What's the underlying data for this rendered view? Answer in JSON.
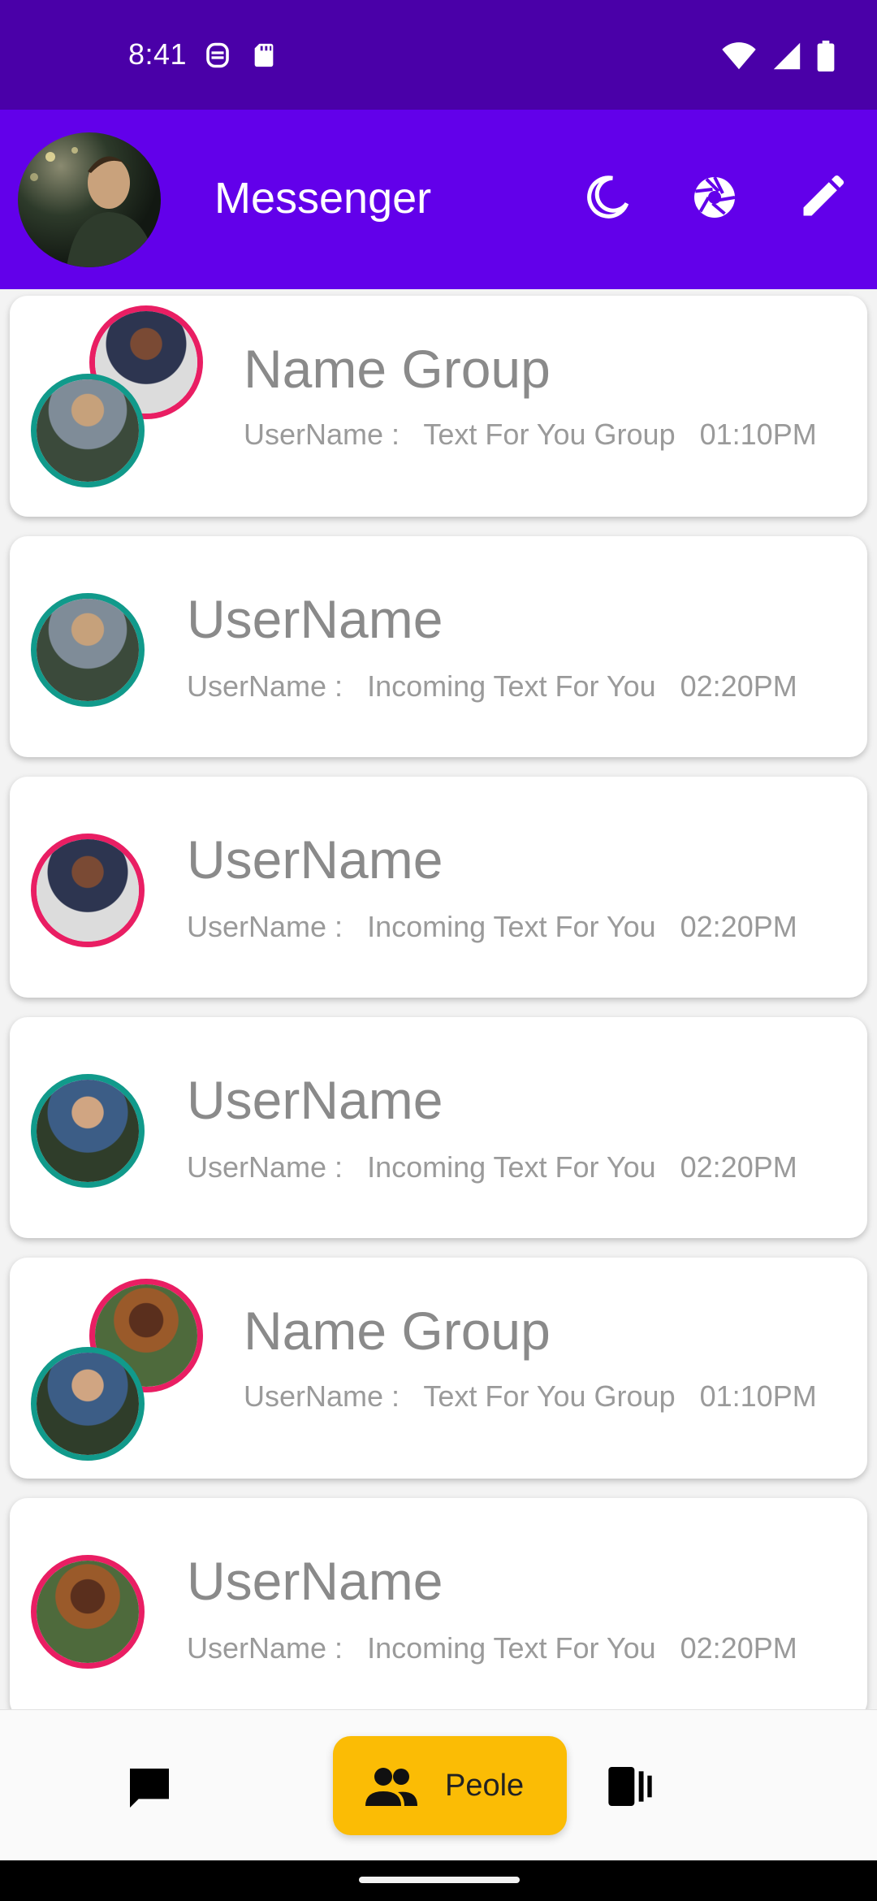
{
  "status_bar": {
    "time": "8:41",
    "left_icons": [
      "face-icon",
      "sd-card-icon"
    ],
    "right_icons": [
      "wifi-icon",
      "signal-icon",
      "battery-icon"
    ]
  },
  "app_bar": {
    "title": "Messenger",
    "background": "#6200ea",
    "actions": [
      "moon-icon",
      "camera-aperture-icon",
      "edit-pencil-icon"
    ]
  },
  "chats": [
    {
      "type": "group",
      "title": "Name Group",
      "sender": "UserName :",
      "message": "Text For You Group",
      "time": "01:10PM"
    },
    {
      "type": "single",
      "title": "UserName",
      "sender": "UserName :",
      "message": "Incoming Text For You",
      "time": "02:20PM"
    },
    {
      "type": "single",
      "title": "UserName",
      "sender": "UserName :",
      "message": "Incoming Text For You",
      "time": "02:20PM"
    },
    {
      "type": "single",
      "title": "UserName",
      "sender": "UserName :",
      "message": "Incoming Text For You",
      "time": "02:20PM"
    },
    {
      "type": "group",
      "title": "Name Group",
      "sender": "UserName :",
      "message": "Text For You Group",
      "time": "01:10PM"
    },
    {
      "type": "single",
      "title": "UserName",
      "sender": "UserName :",
      "message": "Incoming Text For You",
      "time": "02:20PM"
    }
  ],
  "bottom_nav": {
    "items": [
      {
        "icon": "chat-bubble-icon"
      },
      {
        "icon": "people-icon",
        "label": "Peole",
        "selected": true
      },
      {
        "icon": "stories-icon"
      }
    ],
    "accent": "#fbbc05"
  }
}
